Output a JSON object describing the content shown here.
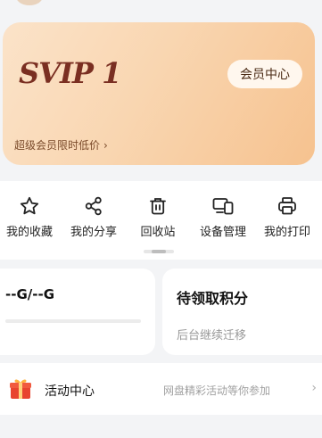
{
  "vip": {
    "logo": "SVIP 1",
    "member_center_label": "会员中心",
    "promo_text": "超级会员限时低价",
    "promo_chevron": "›"
  },
  "tools": [
    {
      "label": "我的收藏",
      "icon": "star-icon"
    },
    {
      "label": "我的分享",
      "icon": "share-icon"
    },
    {
      "label": "回收站",
      "icon": "trash-icon"
    },
    {
      "label": "设备管理",
      "icon": "devices-icon"
    },
    {
      "label": "我的打印",
      "icon": "printer-icon"
    }
  ],
  "scroll_indicator": {
    "position": 0.5
  },
  "storage": {
    "text": "--G/--G",
    "used_fraction": 0
  },
  "points": {
    "title": "待领取积分",
    "subtitle": "后台继续迁移"
  },
  "activity": {
    "title": "活动中心",
    "description": "网盘精彩活动等你参加",
    "icon": "gift-icon",
    "chevron": "›"
  },
  "colors": {
    "vip_text": "#7a2f22",
    "card_gradient_start": "#fbe3c9",
    "card_gradient_end": "#f6c28f",
    "gift_red": "#e8442f"
  }
}
